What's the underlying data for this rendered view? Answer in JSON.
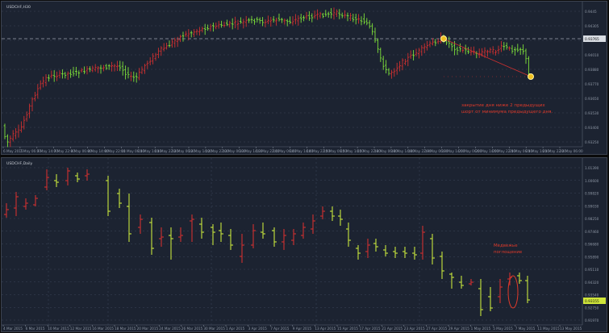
{
  "chart_data": [
    {
      "type": "ohlc",
      "title": "USDCHF,H30",
      "colors": {
        "bull": "#7ee03a",
        "bear": "#d03030",
        "grid": "#3e4a5e",
        "axis_text": "#8d96a4",
        "bg": "#1c2331"
      },
      "y_ticks": [
        "0.9445",
        "0.94305",
        "0.94150",
        "0.94010",
        "0.93880",
        "0.93770",
        "0.93650",
        "0.93530",
        "0.93400",
        "0.93250"
      ],
      "last_price_label": "0.93765",
      "x_ticks": [
        "6 May 2015",
        "7 May 06:00",
        "7 May 14:00",
        "7 May 22:00",
        "8 May 06:00",
        "8 May 14:00",
        "8 May 22:00",
        "11 May 06:00",
        "11 May 14:00",
        "11 May 22:00",
        "12 May 06:00",
        "12 May 14:00",
        "12 May 22:00",
        "13 May 06:00",
        "13 May 14:00",
        "13 May 22:00",
        "14 May 06:00",
        "14 May 14:00",
        "14 May 22:00",
        "15 May 06:00",
        "15 May 14:00",
        "15 May 22:00",
        "18 May 06:00",
        "18 May 14:00",
        "18 May 22:00",
        "19 May 06:00",
        "19 May 14:00",
        "20 May 06:00",
        "20 May 14:00",
        "20 May 22:00",
        "21 May 06:00",
        "21 May 14:00",
        "21 May 22:00",
        "22 May 06:00"
      ],
      "annotation": "закрытие дня ниже 2 предыдущих\nшорт от минимума предыдущего дня."
    },
    {
      "type": "ohlc",
      "title": "USDCHF,Daily",
      "colors": {
        "bull": "#c8e63c",
        "bear": "#d03030"
      },
      "y_ticks": [
        "1.01390",
        "1.00600",
        "0.99820",
        "0.99030",
        "0.98250",
        "0.97460",
        "0.96680",
        "0.95890",
        "0.95110",
        "0.94320",
        "0.93540",
        "0.92750",
        "0.91970"
      ],
      "last_price_label": "0.93155",
      "x_ticks": [
        "4 Mar 2015",
        "6 Mar 2015",
        "10 Mar 2015",
        "12 Mar 2015",
        "16 Mar 2015",
        "18 Mar 2015",
        "20 Mar 2015",
        "24 Mar 2015",
        "26 Mar 2015",
        "30 Mar 2015",
        "1 Apr 2015",
        "3 Apr 2015",
        "7 Apr 2015",
        "9 Apr 2015",
        "13 Apr 2015",
        "15 Apr 2015",
        "17 Apr 2015",
        "21 Apr 2015",
        "23 Apr 2015",
        "27 Apr 2015",
        "29 Apr 2015",
        "1 May 2015",
        "5 May 2015",
        "7 May 2015",
        "11 May 2015",
        "13 May 2015"
      ],
      "annotation": "Медвежье\nпоглощение"
    }
  ]
}
